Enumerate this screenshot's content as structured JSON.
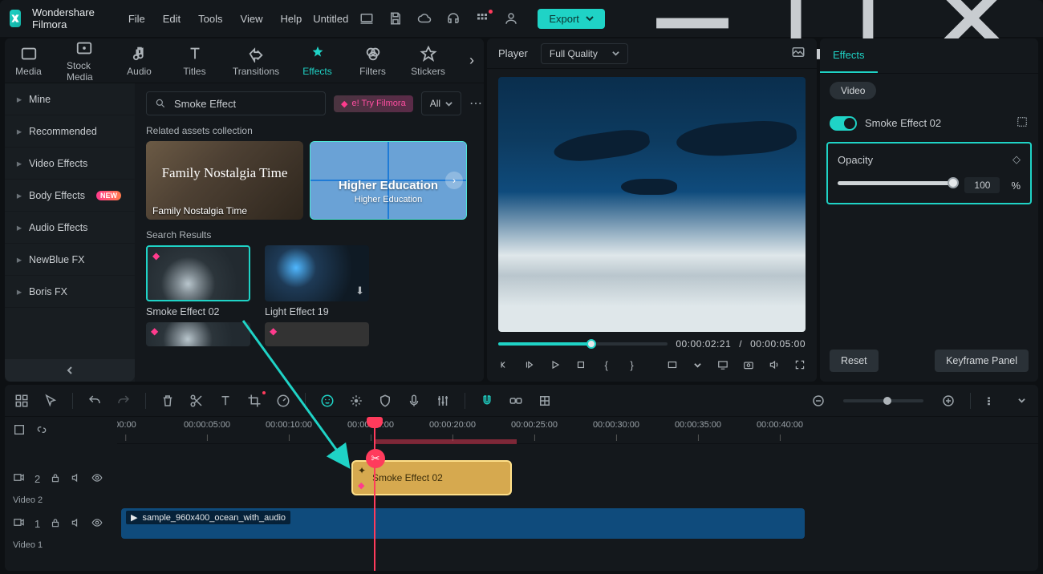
{
  "app_name": "Wondershare Filmora",
  "menus": [
    "File",
    "Edit",
    "Tools",
    "View",
    "Help"
  ],
  "document_title": "Untitled",
  "export_label": "Export",
  "library": {
    "tabs": [
      "Media",
      "Stock Media",
      "Audio",
      "Titles",
      "Transitions",
      "Effects",
      "Filters",
      "Stickers"
    ],
    "active_tab": "Effects",
    "sidebar": [
      {
        "label": "Mine"
      },
      {
        "label": "Recommended"
      },
      {
        "label": "Video Effects"
      },
      {
        "label": "Body Effects",
        "badge": "NEW"
      },
      {
        "label": "Audio Effects"
      },
      {
        "label": "NewBlue FX"
      },
      {
        "label": "Boris FX"
      }
    ],
    "search_value": "Smoke Effect",
    "promo": "e! Try Filmora",
    "filter_all": "All",
    "section_related": "Related assets collection",
    "collections": [
      {
        "title": "Family Nostalgia Time",
        "caption": "Family Nostalgia Time"
      },
      {
        "title": "Higher Education",
        "caption": "Higher Education"
      }
    ],
    "section_results": "Search Results",
    "results": [
      {
        "label": "Smoke Effect 02",
        "selected": true,
        "premium": true
      },
      {
        "label": "Light Effect 19",
        "selected": false,
        "premium": false,
        "downloadable": true
      }
    ]
  },
  "preview": {
    "player_label": "Player",
    "quality": "Full Quality",
    "time_current": "00:00:02:21",
    "time_total": "00:00:05:00"
  },
  "inspector": {
    "tab": "Effects",
    "subtab": "Video",
    "effect_name": "Smoke Effect 02",
    "opacity_label": "Opacity",
    "opacity_value": "100",
    "opacity_unit": "%",
    "reset_label": "Reset",
    "keyframe_label": "Keyframe Panel"
  },
  "timeline": {
    "ruler": [
      "00:00",
      "00:00:05:00",
      "00:00:10:00",
      "00:00:15:00",
      "00:00:20:00",
      "00:00:25:00",
      "00:00:30:00",
      "00:00:35:00",
      "00:00:40:00"
    ],
    "tracks": {
      "v2_badge": "2",
      "v2_name": "Video 2",
      "v1_badge": "1",
      "v1_name": "Video 1"
    },
    "clip_effect": "Smoke Effect 02",
    "clip_video": "sample_960x400_ocean_with_audio"
  }
}
